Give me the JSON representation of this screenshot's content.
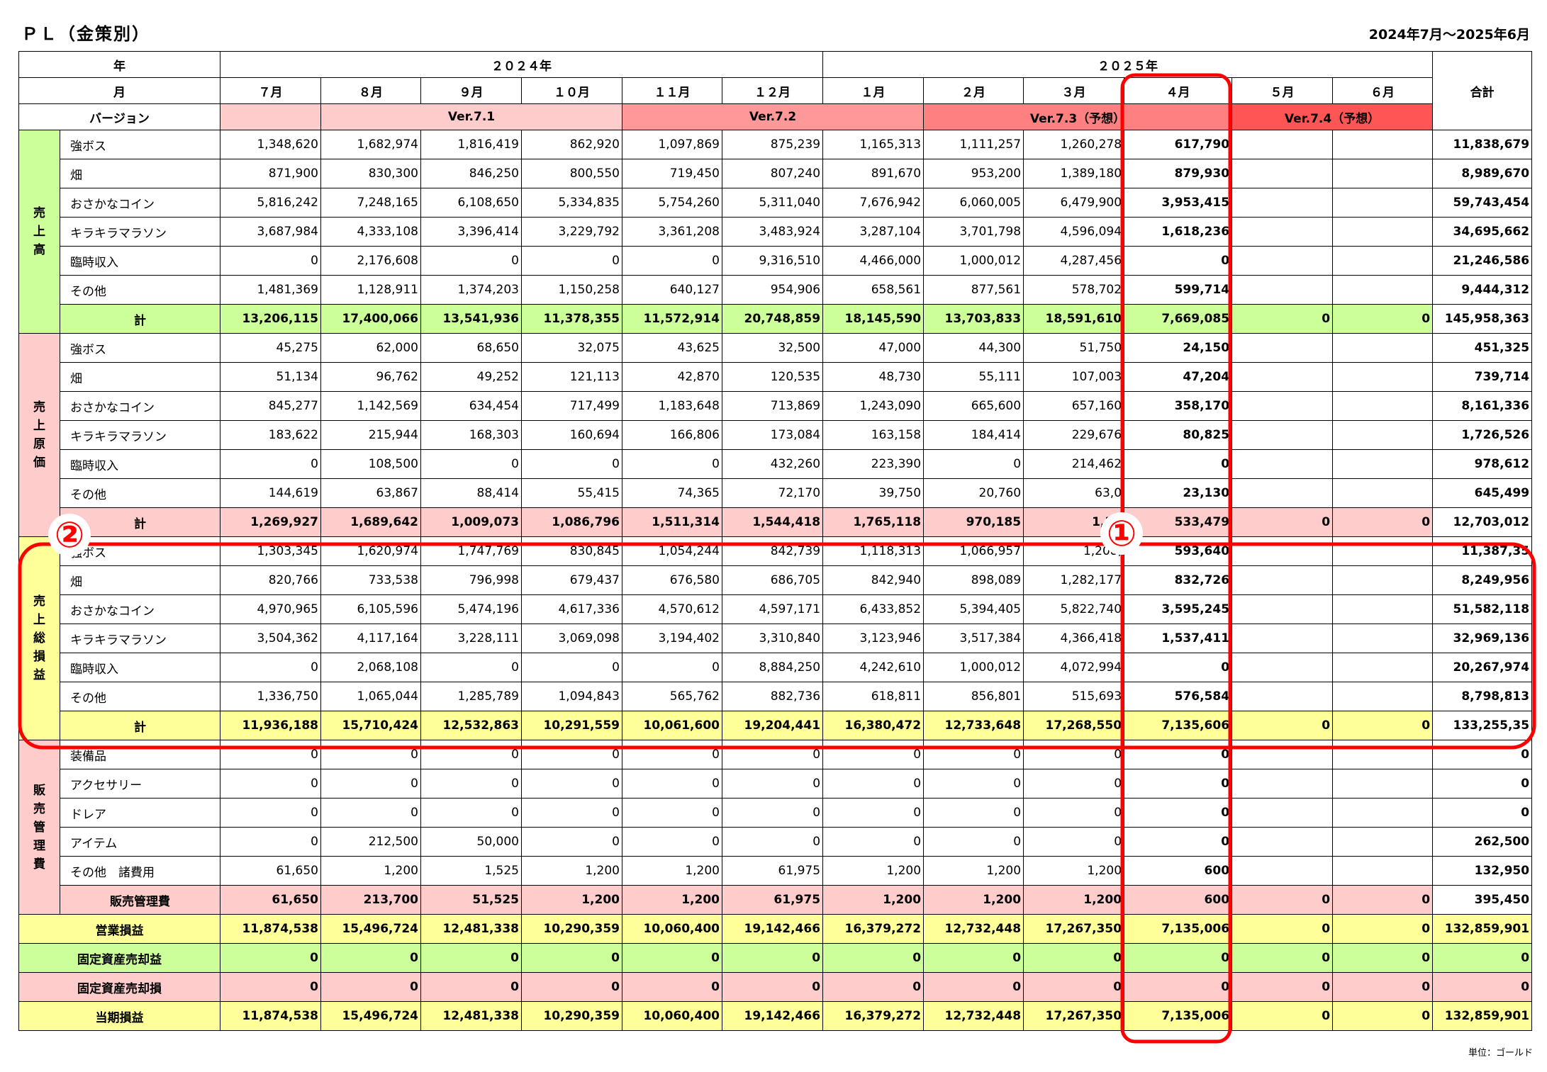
{
  "title": "ＰＬ（金策別）",
  "period": "2024年7月～2025年6月",
  "unit": "単位：ゴールド",
  "header": {
    "year_label": "年",
    "month_label": "月",
    "version_label": "バージョン",
    "total_label": "合計",
    "years": [
      "２０２４年",
      "２０２５年"
    ],
    "months": [
      "７月",
      "８月",
      "９月",
      "１０月",
      "１１月",
      "１２月",
      "１月",
      "２月",
      "３月",
      "４月",
      "５月",
      "６月"
    ],
    "versions": [
      "",
      "Ver.7.1",
      "Ver.7.2",
      "Ver.7.3（予想）",
      "Ver.7.4（予想）"
    ]
  },
  "sections": [
    {
      "name": "売\n上\n高",
      "color": "#ccff99",
      "rows": [
        {
          "label": "強ボス",
          "values": [
            "1,348,620",
            "1,682,974",
            "1,816,419",
            "862,920",
            "1,097,869",
            "875,239",
            "1,165,313",
            "1,111,257",
            "1,260,278",
            "617,790",
            "",
            ""
          ],
          "total": "11,838,679"
        },
        {
          "label": "畑",
          "values": [
            "871,900",
            "830,300",
            "846,250",
            "800,550",
            "719,450",
            "807,240",
            "891,670",
            "953,200",
            "1,389,180",
            "879,930",
            "",
            ""
          ],
          "total": "8,989,670"
        },
        {
          "label": "おさかなコイン",
          "values": [
            "5,816,242",
            "7,248,165",
            "6,108,650",
            "5,334,835",
            "5,754,260",
            "5,311,040",
            "7,676,942",
            "6,060,005",
            "6,479,900",
            "3,953,415",
            "",
            ""
          ],
          "total": "59,743,454"
        },
        {
          "label": "キラキラマラソン",
          "values": [
            "3,687,984",
            "4,333,108",
            "3,396,414",
            "3,229,792",
            "3,361,208",
            "3,483,924",
            "3,287,104",
            "3,701,798",
            "4,596,094",
            "1,618,236",
            "",
            ""
          ],
          "total": "34,695,662"
        },
        {
          "label": "臨時収入",
          "values": [
            "0",
            "2,176,608",
            "0",
            "0",
            "0",
            "9,316,510",
            "4,466,000",
            "1,000,012",
            "4,287,456",
            "0",
            "",
            ""
          ],
          "total": "21,246,586"
        },
        {
          "label": "その他",
          "values": [
            "1,481,369",
            "1,128,911",
            "1,374,203",
            "1,150,258",
            "640,127",
            "954,906",
            "658,561",
            "877,561",
            "578,702",
            "599,714",
            "",
            ""
          ],
          "total": "9,444,312"
        }
      ],
      "subtotal": {
        "label": "計",
        "values": [
          "13,206,115",
          "17,400,066",
          "13,541,936",
          "11,378,355",
          "11,572,914",
          "20,748,859",
          "18,145,590",
          "13,703,833",
          "18,591,610",
          "7,669,085",
          "0",
          "0"
        ],
        "total": "145,958,363"
      }
    },
    {
      "name": "売\n上\n原\n価",
      "color": "#ffcccc",
      "rows": [
        {
          "label": "強ボス",
          "values": [
            "45,275",
            "62,000",
            "68,650",
            "32,075",
            "43,625",
            "32,500",
            "47,000",
            "44,300",
            "51,750",
            "24,150",
            "",
            ""
          ],
          "total": "451,325"
        },
        {
          "label": "畑",
          "values": [
            "51,134",
            "96,762",
            "49,252",
            "121,113",
            "42,870",
            "120,535",
            "48,730",
            "55,111",
            "107,003",
            "47,204",
            "",
            ""
          ],
          "total": "739,714"
        },
        {
          "label": "おさかなコイン",
          "values": [
            "845,277",
            "1,142,569",
            "634,454",
            "717,499",
            "1,183,648",
            "713,869",
            "1,243,090",
            "665,600",
            "657,160",
            "358,170",
            "",
            ""
          ],
          "total": "8,161,336"
        },
        {
          "label": "キラキラマラソン",
          "values": [
            "183,622",
            "215,944",
            "168,303",
            "160,694",
            "166,806",
            "173,084",
            "163,158",
            "184,414",
            "229,676",
            "80,825",
            "",
            ""
          ],
          "total": "1,726,526"
        },
        {
          "label": "臨時収入",
          "values": [
            "0",
            "108,500",
            "0",
            "0",
            "0",
            "432,260",
            "223,390",
            "0",
            "214,462",
            "0",
            "",
            ""
          ],
          "total": "978,612"
        },
        {
          "label": "その他",
          "values": [
            "144,619",
            "63,867",
            "88,414",
            "55,415",
            "74,365",
            "72,170",
            "39,750",
            "20,760",
            "63,0",
            "23,130",
            "",
            ""
          ],
          "total": "645,499"
        }
      ],
      "subtotal": {
        "label": "計",
        "values": [
          "1,269,927",
          "1,689,642",
          "1,009,073",
          "1,086,796",
          "1,511,314",
          "1,544,418",
          "1,765,118",
          "970,185",
          "1,32",
          "533,479",
          "0",
          "0"
        ],
        "total": "12,703,012"
      }
    },
    {
      "name": "売\n上\n総\n損\n益",
      "color": "#ffff99",
      "rows": [
        {
          "label": "強ボス",
          "values": [
            "1,303,345",
            "1,620,974",
            "1,747,769",
            "830,845",
            "1,054,244",
            "842,739",
            "1,118,313",
            "1,066,957",
            "1,208,",
            "593,640",
            "",
            ""
          ],
          "total": "11,387,35"
        },
        {
          "label": "畑",
          "values": [
            "820,766",
            "733,538",
            "796,998",
            "679,437",
            "676,580",
            "686,705",
            "842,940",
            "898,089",
            "1,282,177",
            "832,726",
            "",
            ""
          ],
          "total": "8,249,956"
        },
        {
          "label": "おさかなコイン",
          "values": [
            "4,970,965",
            "6,105,596",
            "5,474,196",
            "4,617,336",
            "4,570,612",
            "4,597,171",
            "6,433,852",
            "5,394,405",
            "5,822,740",
            "3,595,245",
            "",
            ""
          ],
          "total": "51,582,118"
        },
        {
          "label": "キラキラマラソン",
          "values": [
            "3,504,362",
            "4,117,164",
            "3,228,111",
            "3,069,098",
            "3,194,402",
            "3,310,840",
            "3,123,946",
            "3,517,384",
            "4,366,418",
            "1,537,411",
            "",
            ""
          ],
          "total": "32,969,136"
        },
        {
          "label": "臨時収入",
          "values": [
            "0",
            "2,068,108",
            "0",
            "0",
            "0",
            "8,884,250",
            "4,242,610",
            "1,000,012",
            "4,072,994",
            "0",
            "",
            ""
          ],
          "total": "20,267,974"
        },
        {
          "label": "その他",
          "values": [
            "1,336,750",
            "1,065,044",
            "1,285,789",
            "1,094,843",
            "565,762",
            "882,736",
            "618,811",
            "856,801",
            "515,693",
            "576,584",
            "",
            ""
          ],
          "total": "8,798,813"
        }
      ],
      "subtotal": {
        "label": "計",
        "values": [
          "11,936,188",
          "15,710,424",
          "12,532,863",
          "10,291,559",
          "10,061,600",
          "19,204,441",
          "16,380,472",
          "12,733,648",
          "17,268,550",
          "7,135,606",
          "0",
          "0"
        ],
        "total": "133,255,35"
      }
    },
    {
      "name": "販\n売\n管\n理\n費",
      "color": "#ffcccc",
      "rows": [
        {
          "label": "装備品",
          "values": [
            "0",
            "0",
            "0",
            "0",
            "0",
            "0",
            "0",
            "0",
            "0",
            "0",
            "",
            ""
          ],
          "total": "0"
        },
        {
          "label": "アクセサリー",
          "values": [
            "0",
            "0",
            "0",
            "0",
            "0",
            "0",
            "0",
            "0",
            "0",
            "0",
            "",
            ""
          ],
          "total": "0"
        },
        {
          "label": "ドレア",
          "values": [
            "0",
            "0",
            "0",
            "0",
            "0",
            "0",
            "0",
            "0",
            "0",
            "0",
            "",
            ""
          ],
          "total": "0"
        },
        {
          "label": "アイテム",
          "values": [
            "0",
            "212,500",
            "50,000",
            "0",
            "0",
            "0",
            "0",
            "0",
            "0",
            "0",
            "",
            ""
          ],
          "total": "262,500"
        },
        {
          "label": "その他　諸費用",
          "values": [
            "61,650",
            "1,200",
            "1,525",
            "1,200",
            "1,200",
            "61,975",
            "1,200",
            "1,200",
            "1,200",
            "600",
            "",
            ""
          ],
          "total": "132,950"
        }
      ],
      "subtotal": {
        "label": "販売管理費",
        "values": [
          "61,650",
          "213,700",
          "51,525",
          "1,200",
          "1,200",
          "61,975",
          "1,200",
          "1,200",
          "1,200",
          "600",
          "0",
          "0"
        ],
        "total": "395,450"
      }
    }
  ],
  "summary": [
    {
      "label": "営業損益",
      "color": "#ffff99",
      "values": [
        "11,874,538",
        "15,496,724",
        "12,481,338",
        "10,290,359",
        "10,060,400",
        "19,142,466",
        "16,379,272",
        "12,732,448",
        "17,267,350",
        "7,135,006",
        "0",
        "0"
      ],
      "total": "132,859,901"
    },
    {
      "label": "固定資産売却益",
      "color": "#ccff99",
      "values": [
        "0",
        "0",
        "0",
        "0",
        "0",
        "0",
        "0",
        "0",
        "0",
        "0",
        "0",
        "0"
      ],
      "total": "0"
    },
    {
      "label": "固定資産売却損",
      "color": "#ffcccc",
      "values": [
        "0",
        "0",
        "0",
        "0",
        "0",
        "0",
        "0",
        "0",
        "0",
        "0",
        "0",
        "0"
      ],
      "total": "0"
    },
    {
      "label": "当期損益",
      "color": "#ffff99",
      "values": [
        "11,874,538",
        "15,496,724",
        "12,481,338",
        "10,290,359",
        "10,060,400",
        "19,142,466",
        "16,379,272",
        "12,732,448",
        "17,267,350",
        "7,135,006",
        "0",
        "0"
      ],
      "total": "132,859,901"
    }
  ],
  "annotations": {
    "callout_1": "①",
    "callout_2": "②",
    "highlight_color": "#ff0000"
  }
}
